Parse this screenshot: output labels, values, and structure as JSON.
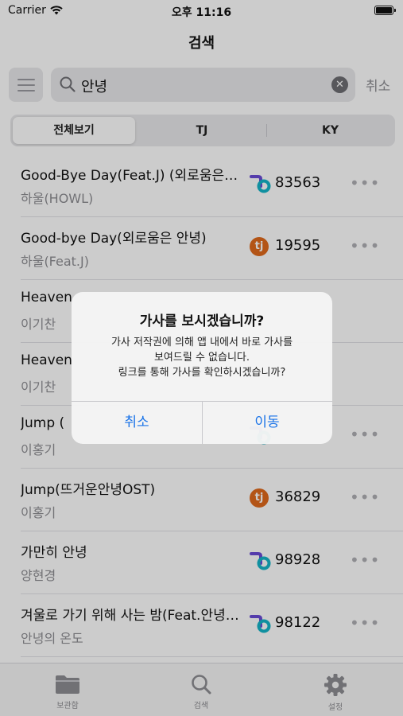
{
  "status_bar": {
    "carrier": "Carrier",
    "time": "오후 11:16"
  },
  "nav": {
    "title": "검색"
  },
  "search": {
    "value": "안녕",
    "cancel_label": "취소"
  },
  "segments": [
    {
      "label": "전체보기",
      "active": true
    },
    {
      "label": "TJ",
      "active": false
    },
    {
      "label": "KY",
      "active": false
    }
  ],
  "results": [
    {
      "title": "Good-Bye Day(Feat.J) (외로움은 안녕)",
      "artist": "하울(HOWL)",
      "brand": "ky",
      "code": "83563"
    },
    {
      "title": "Good-bye Day(외로움은 안녕)",
      "artist": "하울(Feat.J)",
      "brand": "tj",
      "code": "19595"
    },
    {
      "title": "Heaven",
      "artist": "이기찬",
      "brand": "",
      "code": ""
    },
    {
      "title": "Heaven",
      "artist": "이기찬",
      "brand": "",
      "code": ""
    },
    {
      "title": "Jump (",
      "artist": "이홍기",
      "brand": "ky",
      "code": ""
    },
    {
      "title": "Jump(뜨거운안녕OST)",
      "artist": "이홍기",
      "brand": "tj",
      "code": "36829"
    },
    {
      "title": "가만히 안녕",
      "artist": "양현경",
      "brand": "ky",
      "code": "98928"
    },
    {
      "title": "겨울로 가기 위해 사는 밤(Feat.안녕의 온도)",
      "artist": "안녕의 온도",
      "brand": "ky",
      "code": "98122"
    }
  ],
  "tabs": [
    {
      "label": "보관함",
      "icon": "folder-icon"
    },
    {
      "label": "검색",
      "icon": "search-icon"
    },
    {
      "label": "설정",
      "icon": "gear-icon"
    }
  ],
  "alert": {
    "title": "가사를 보시겠습니까?",
    "message": [
      "가사 저작권에 의해 앱 내에서 바로 가사를",
      "보여드릴 수 없습니다.",
      "링크를 통해 가사를 확인하시겠습니까?"
    ],
    "cancel_label": "취소",
    "confirm_label": "이동"
  },
  "colors": {
    "accent": "#1a73e8",
    "tj_brand": "#e06a1c",
    "ky_purple": "#6a4bd6",
    "ky_teal": "#14b5c9"
  }
}
